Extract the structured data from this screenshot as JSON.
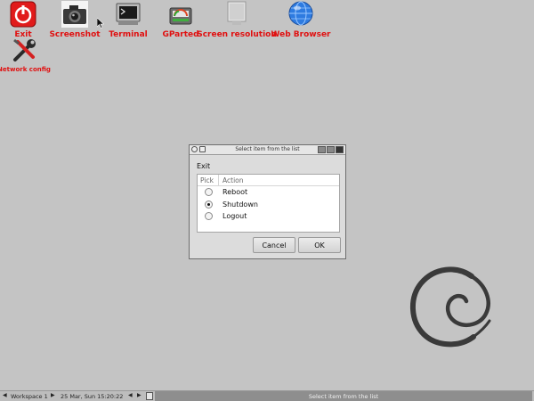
{
  "desktop": {
    "icons": [
      {
        "id": "exit",
        "label": "Exit"
      },
      {
        "id": "screenshot",
        "label": "Screenshot"
      },
      {
        "id": "terminal",
        "label": "Terminal"
      },
      {
        "id": "gparted",
        "label": "GParted"
      },
      {
        "id": "screen_resolution",
        "label": "Screen resolution"
      },
      {
        "id": "web_browser",
        "label": "Web Browser"
      },
      {
        "id": "network_config",
        "label": "Network config"
      }
    ]
  },
  "dialog": {
    "title": "Select item from the list",
    "prompt": "Exit",
    "columns": [
      "Pick",
      "Action"
    ],
    "items": [
      {
        "label": "Reboot",
        "selected": false
      },
      {
        "label": "Shutdown",
        "selected": true
      },
      {
        "label": "Logout",
        "selected": false
      }
    ],
    "cancel_label": "Cancel",
    "ok_label": "OK"
  },
  "taskbar": {
    "workspace": "Workspace 1",
    "clock": "25 Mar, Sun 15:20:22",
    "task_title": "Select item from the list"
  },
  "colors": {
    "desktop_bg": "#c4c4c4",
    "icon_label": "#e01010"
  }
}
